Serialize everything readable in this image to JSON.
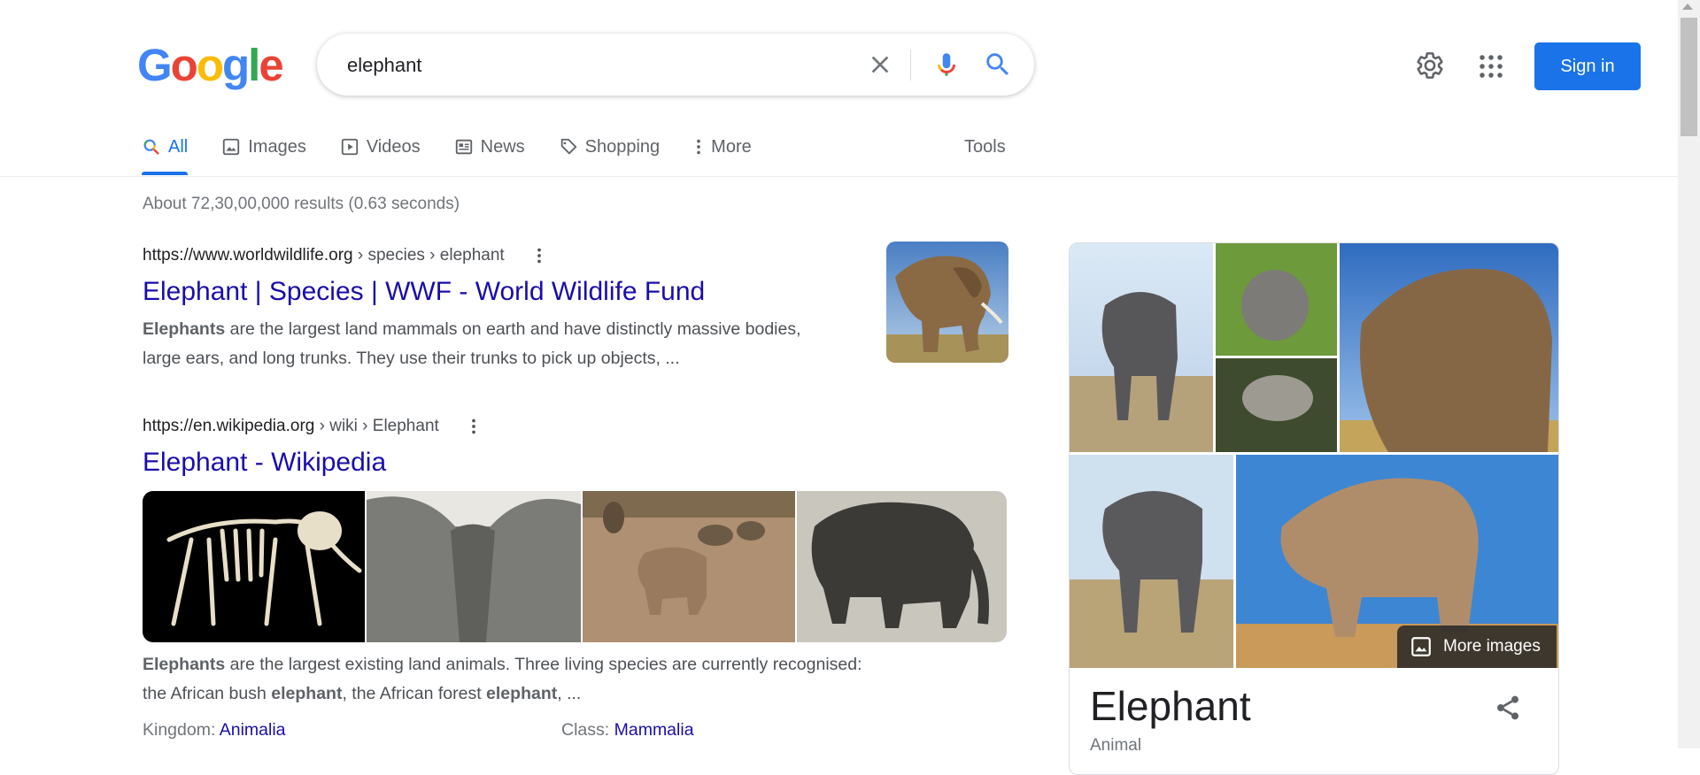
{
  "header": {
    "logo_letters": [
      "G",
      "o",
      "o",
      "g",
      "l",
      "e"
    ],
    "logo_colors": [
      "#4285f4",
      "#ea4335",
      "#fbbc05",
      "#4285f4",
      "#34a853",
      "#ea4335"
    ],
    "search_value": "elephant",
    "signin_label": "Sign in",
    "icons": [
      "clear-icon",
      "mic-icon",
      "search-icon",
      "settings-icon",
      "apps-icon"
    ]
  },
  "tabs": [
    {
      "label": "All",
      "icon": "search-icon",
      "active": true
    },
    {
      "label": "Images",
      "icon": "image-icon"
    },
    {
      "label": "Videos",
      "icon": "play-icon"
    },
    {
      "label": "News",
      "icon": "news-icon"
    },
    {
      "label": "Shopping",
      "icon": "tag-icon"
    },
    {
      "label": "More",
      "icon": "kebab-icon"
    }
  ],
  "tools_label": "Tools",
  "result_stats": "About 72,30,00,000 results (0.63 seconds)",
  "results": [
    {
      "url_host": "https://www.worldwildlife.org",
      "url_path": " › species › elephant",
      "title": "Elephant | Species | WWF - World Wildlife Fund",
      "snippet_bold": "Elephants",
      "snippet_rest": " are the largest land mammals on earth and have distinctly massive bodies,",
      "snippet_line2": "large ears, and long trunks. They use their trunks to pick up objects, ..."
    },
    {
      "url_host": "https://en.wikipedia.org",
      "url_path": " › wiki › Elephant",
      "title": "Elephant - Wikipedia",
      "snippet_bold": "Elephants",
      "snippet_rest": " are the largest existing land animals. Three living species are currently recognised:",
      "snippet_line2_a": "the African bush ",
      "snippet_line2_b": "elephant",
      "snippet_line2_c": ", the African forest ",
      "snippet_line2_d": "elephant",
      "snippet_line2_e": ", ...",
      "facts": [
        {
          "label": "Kingdom: ",
          "value": "Animalia"
        },
        {
          "label": "Class: ",
          "value": "Mammalia"
        }
      ]
    }
  ],
  "knowledge_panel": {
    "title": "Elephant",
    "subtitle": "Animal",
    "more_images_label": "More images"
  }
}
